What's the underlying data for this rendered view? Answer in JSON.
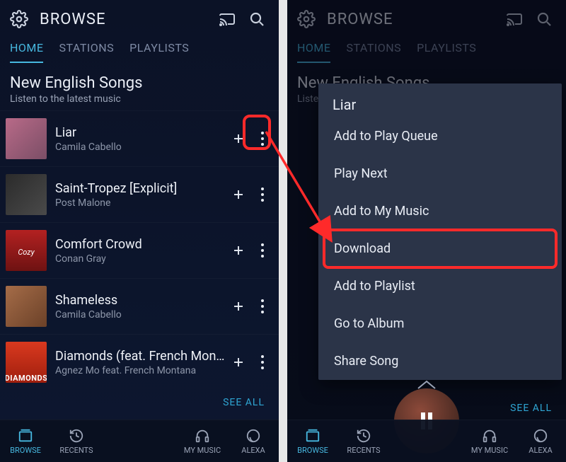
{
  "colors": {
    "accent": "#47b8e0",
    "highlight": "#ff2a2a"
  },
  "header": {
    "title": "BROWSE",
    "icons": {
      "settings": "gear-icon",
      "cast": "cast-icon",
      "search": "search-icon"
    }
  },
  "tabs": [
    "HOME",
    "STATIONS",
    "PLAYLISTS"
  ],
  "active_tab": 0,
  "section": {
    "title": "New English Songs",
    "subtitle": "Listen to the latest music",
    "see_all": "SEE ALL",
    "songs": [
      {
        "title": "Liar",
        "artist": "Camila Cabello"
      },
      {
        "title": "Saint-Tropez [Explicit]",
        "artist": "Post Malone"
      },
      {
        "title": "Comfort Crowd",
        "artist": "Conan Gray"
      },
      {
        "title": "Shameless",
        "artist": "Camila Cabello"
      },
      {
        "title": "Diamonds (feat. French Montana)",
        "artist": "Agnez Mo feat. French Montana"
      }
    ]
  },
  "bottom_nav": {
    "items": [
      "BROWSE",
      "RECENTS",
      "MY MUSIC",
      "ALEXA"
    ],
    "labels_truncated_left": [
      "BROWSE",
      "RECENTS",
      "MY MUSIC",
      "ALEXA"
    ],
    "active": 0
  },
  "context_menu": {
    "title": "Liar",
    "items": [
      "Add to Play Queue",
      "Play Next",
      "Add to My Music",
      "Download",
      "Add to Playlist",
      "Go to Album",
      "Share Song"
    ],
    "highlighted_index": 3
  },
  "annotation": {
    "highlight_more_button_song_index": 0,
    "arrow_from": "more-button",
    "arrow_to": "Download"
  }
}
